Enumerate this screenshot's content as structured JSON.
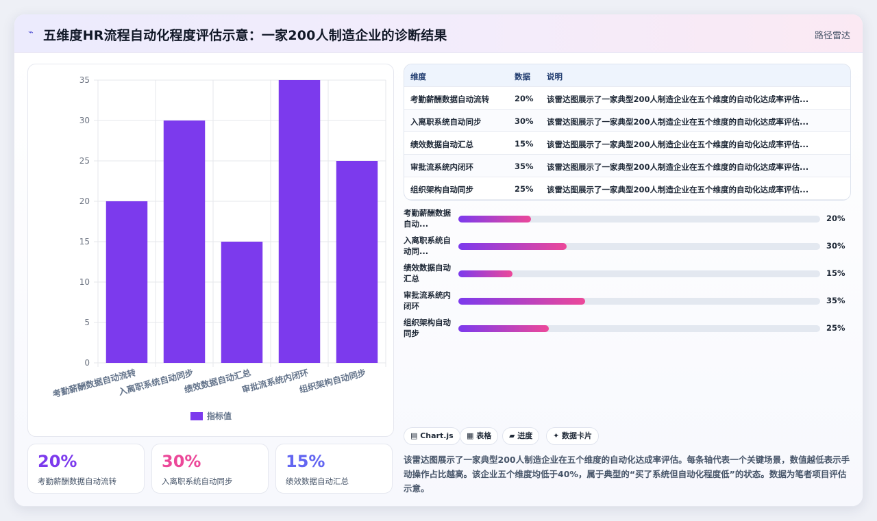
{
  "header": {
    "title": "五维度HR流程自动化程度评估示意：一家200人制造企业的诊断结果",
    "link": "路径雷达"
  },
  "chart_data": {
    "type": "bar",
    "categories": [
      "考勤薪酬数据自动流转",
      "入离职系统自动同步",
      "绩效数据自动汇总",
      "审批流系统内闭环",
      "组织架构自动同步"
    ],
    "series": [
      {
        "name": "指标值",
        "values": [
          20,
          30,
          15,
          35,
          25
        ]
      }
    ],
    "ylim": [
      0,
      35
    ],
    "yticks": [
      0,
      5,
      10,
      15,
      20,
      25,
      30,
      35
    ],
    "bar_color": "#7c3aed",
    "legend": "bottom"
  },
  "stats": [
    {
      "value": "20%",
      "label": "考勤薪酬数据自动流转",
      "color": "#7c3aed"
    },
    {
      "value": "30%",
      "label": "入离职系统自动同步",
      "color": "#ec4899"
    },
    {
      "value": "15%",
      "label": "绩效数据自动汇总",
      "color": "#6366f1"
    }
  ],
  "table": {
    "headers": [
      "维度",
      "数据",
      "说明"
    ],
    "rows": [
      [
        "考勤薪酬数据自动流转",
        "20%",
        "该雷达图展示了一家典型200人制造企业在五个维度的自动化达成率评估..."
      ],
      [
        "入离职系统自动同步",
        "30%",
        "该雷达图展示了一家典型200人制造企业在五个维度的自动化达成率评估..."
      ],
      [
        "绩效数据自动汇总",
        "15%",
        "该雷达图展示了一家典型200人制造企业在五个维度的自动化达成率评估..."
      ],
      [
        "审批流系统内闭环",
        "35%",
        "该雷达图展示了一家典型200人制造企业在五个维度的自动化达成率评估..."
      ],
      [
        "组织架构自动同步",
        "25%",
        "该雷达图展示了一家典型200人制造企业在五个维度的自动化达成率评估..."
      ]
    ]
  },
  "progress": [
    {
      "label": "考勤薪酬数据自动...",
      "value": "20%",
      "fraction": 0.2
    },
    {
      "label": "入离职系统自动同...",
      "value": "30%",
      "fraction": 0.3
    },
    {
      "label": "绩效数据自动汇总",
      "value": "15%",
      "fraction": 0.15
    },
    {
      "label": "审批流系统内闭环",
      "value": "35%",
      "fraction": 0.35
    },
    {
      "label": "组织架构自动同步",
      "value": "25%",
      "fraction": 0.25
    }
  ],
  "tags": [
    "▤ Chart.js",
    "▦ 表格",
    "▰ 进度",
    "✦ 数据卡片"
  ],
  "description": "该雷达图展示了一家典型200人制造企业在五个维度的自动化达成率评估。每条轴代表一个关键场景，数值越低表示手动操作占比越高。该企业五个维度均低于40%，属于典型的“买了系统但自动化程度低”的状态。数据为笔者项目评估示意。"
}
